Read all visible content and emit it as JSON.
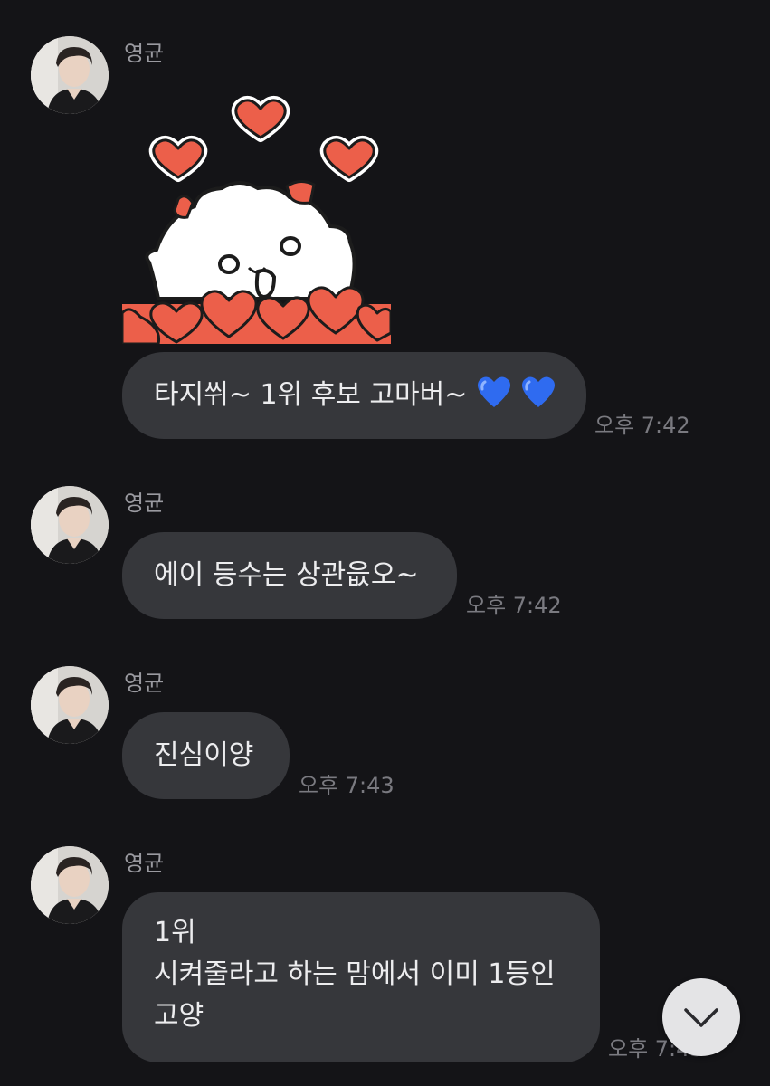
{
  "messages": [
    {
      "sender": "영균",
      "text_before_emoji": "타지쒸~ 1위 후보 고마버~",
      "emojis": [
        "blue-heart-icon",
        "blue-heart-icon"
      ],
      "time": "오후 7:42"
    },
    {
      "sender": "영균",
      "text": "에이 등수는 상관읎오~",
      "time": "오후 7:42"
    },
    {
      "sender": "영균",
      "text": "진심이양",
      "time": "오후 7:43"
    },
    {
      "sender": "영균",
      "lines": [
        "1위",
        "시켜줄라고 하는 맘에서 이미 1등인",
        "고양"
      ],
      "time": "오후 7:43"
    }
  ],
  "colors": {
    "background": "#141417",
    "bubble": "#36373b",
    "text": "#ececee",
    "timestamp": "#7a7a80",
    "sender": "#9a9aa0",
    "heart_emoji": "#2f6bf0",
    "sticker_heart": "#ec5f4a"
  },
  "icons": {
    "sticker": "white-cat-with-hearts-sticker",
    "scroll_button": "chevron-down-icon"
  }
}
